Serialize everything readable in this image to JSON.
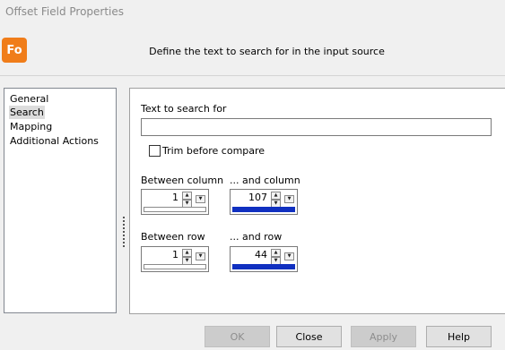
{
  "window": {
    "title": "Offset Field Properties"
  },
  "header": {
    "logo_text": "Fo",
    "text": "Define the text to search for in the input source"
  },
  "nav": {
    "items": [
      {
        "label": "General"
      },
      {
        "label": "Search",
        "selected": true
      },
      {
        "label": "Mapping"
      },
      {
        "label": "Additional Actions"
      }
    ]
  },
  "form": {
    "search_label": "Text to search for",
    "search_value": "",
    "trim_label": "Trim before compare",
    "trim_checked": false,
    "between_column": {
      "label": "Between column",
      "value": "1",
      "level": 0
    },
    "and_column": {
      "label": "... and column",
      "value": "107",
      "level": 1
    },
    "between_row": {
      "label": "Between row",
      "value": "1",
      "level": 0
    },
    "and_row": {
      "label": "... and row",
      "value": "44",
      "level": 1
    }
  },
  "buttons": {
    "ok": "OK",
    "close": "Close",
    "apply": "Apply",
    "help": "Help"
  },
  "icons": {
    "up": "up-arrow-icon",
    "down": "down-arrow-icon"
  },
  "colors": {
    "logo": "#f07d1a",
    "slider_fill": "#1030c0"
  }
}
